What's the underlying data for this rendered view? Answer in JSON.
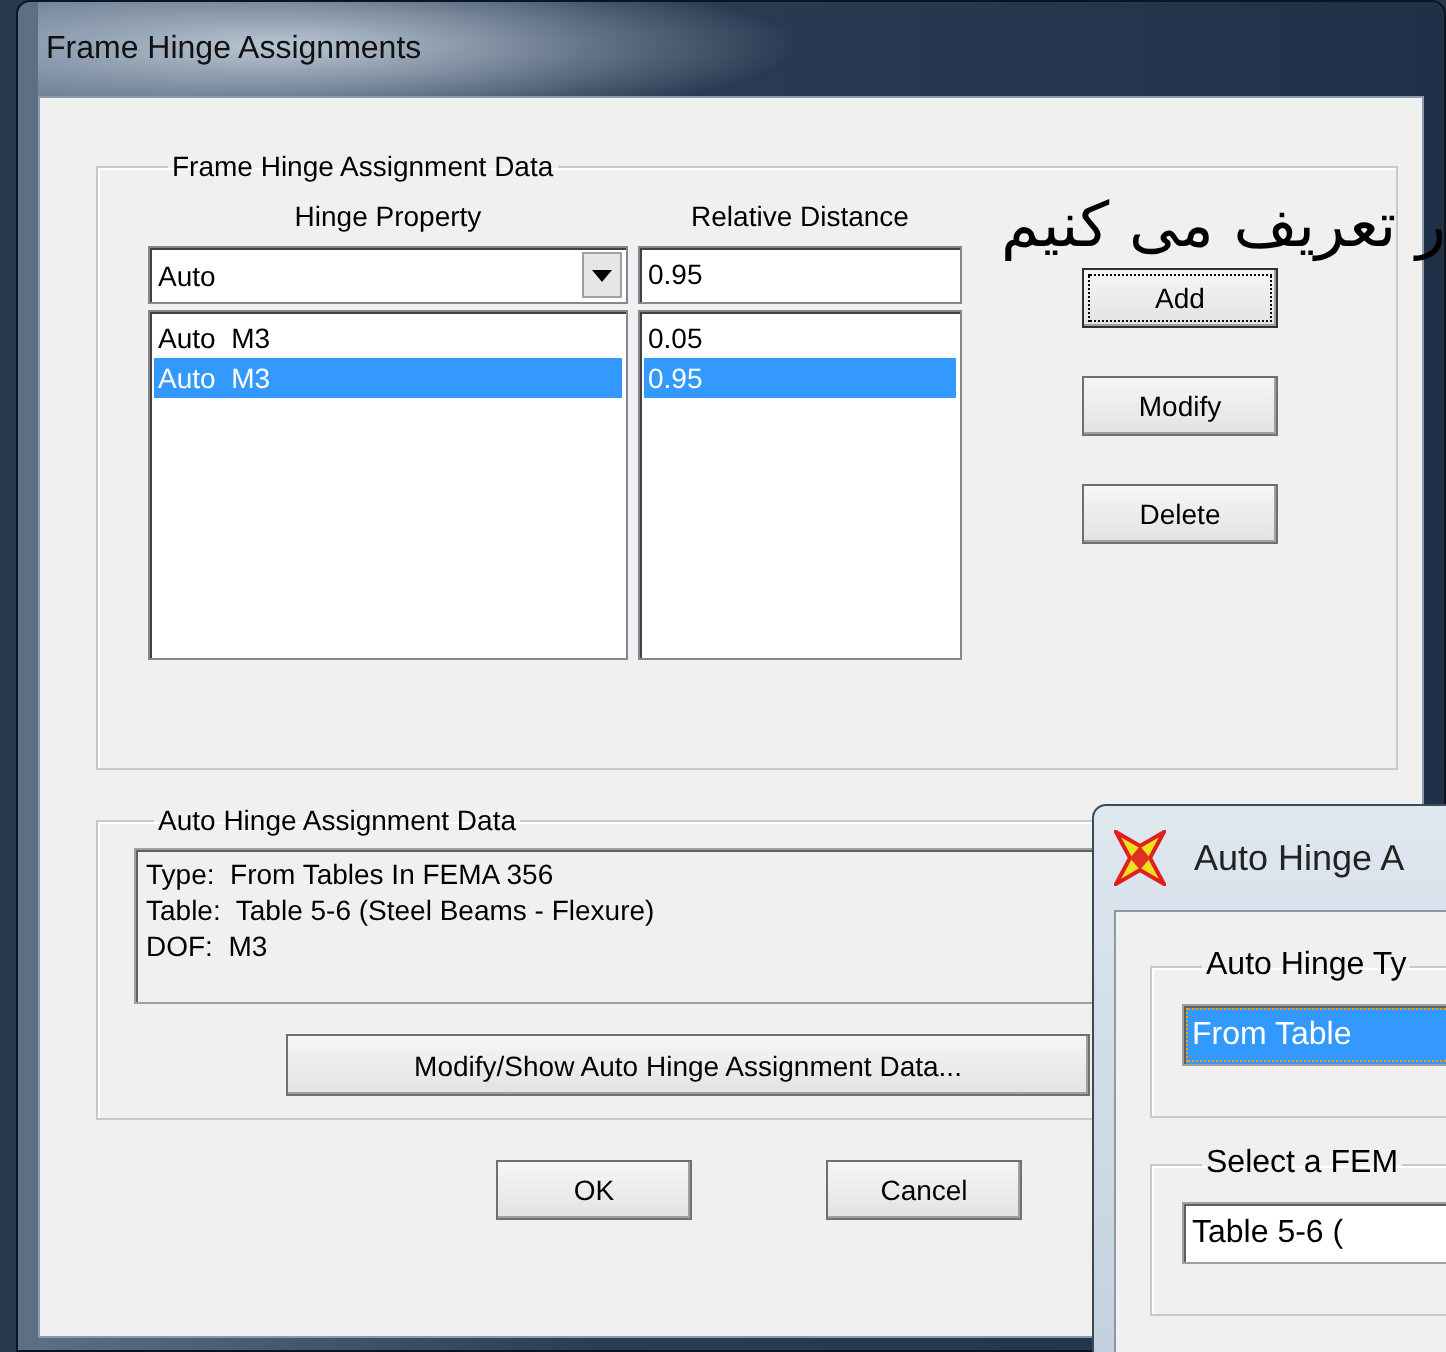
{
  "window": {
    "title": "Frame Hinge Assignments"
  },
  "assignment_group": {
    "title": "Frame Hinge Assignment Data",
    "hinge_property_label": "Hinge Property",
    "relative_distance_label": "Relative Distance",
    "hinge_property_value": "Auto",
    "relative_distance_value": "0.95",
    "rows": [
      {
        "hinge": "Auto  M3",
        "distance": "0.05",
        "selected": false
      },
      {
        "hinge": "Auto  M3",
        "distance": "0.95",
        "selected": true
      }
    ],
    "buttons": [
      {
        "label": "Add",
        "focused": true
      },
      {
        "label": "Modify",
        "focused": false
      },
      {
        "label": "Delete",
        "focused": false
      }
    ]
  },
  "auto_group": {
    "title": "Auto Hinge Assignment Data",
    "lines": [
      "Type:  From Tables In FEMA 356",
      "Table:  Table 5-6 (Steel Beams - Flexure)",
      "DOF:  M3"
    ],
    "button": "Modify/Show Auto Hinge Assignment Data..."
  },
  "buttons": [
    "OK",
    "Cancel"
  ],
  "overlay_text": "ر تعریف می کنیم",
  "child_window": {
    "title": "Auto Hinge A",
    "type_group": "Auto Hinge Ty",
    "type_value": "From Table",
    "type_focused": true,
    "table_group": "Select a FEM",
    "table_value": "Table 5-6 ("
  }
}
